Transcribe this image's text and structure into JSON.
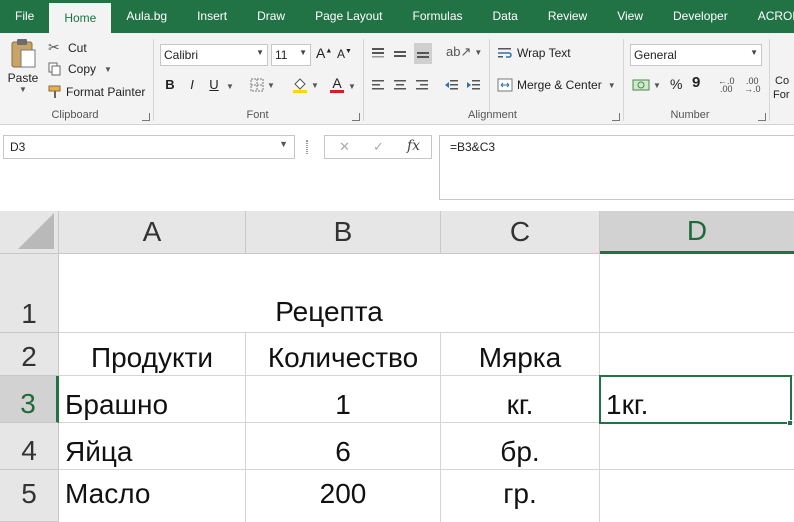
{
  "tabs": [
    "File",
    "Home",
    "Aula.bg",
    "Insert",
    "Draw",
    "Page Layout",
    "Formulas",
    "Data",
    "Review",
    "View",
    "Developer",
    "ACROBAT"
  ],
  "ribbon": {
    "clipboard": {
      "paste": "Paste",
      "cut": "Cut",
      "copy": "Copy",
      "format_painter": "Format Painter",
      "label": "Clipboard"
    },
    "font": {
      "name": "Calibri",
      "size": "11",
      "bold": "B",
      "italic": "I",
      "underline": "U",
      "font_color_letter": "A",
      "label": "Font"
    },
    "alignment": {
      "wrap_text": "Wrap Text",
      "merge_center": "Merge & Center",
      "label": "Alignment"
    },
    "number": {
      "format": "General",
      "percent": "%",
      "comma": "9",
      "label": "Number"
    },
    "styles": {
      "partial_top": "Co",
      "partial_bottom": "For"
    },
    "colors": {
      "green": "#217346",
      "fill_yellow": "#ffd700",
      "font_red": "#e0191e"
    }
  },
  "formula_bar": {
    "name_box": "D3",
    "cancel": "✕",
    "enter": "✓",
    "fx": "fx",
    "formula": "=B3&C3"
  },
  "sheet": {
    "columns": [
      "A",
      "B",
      "C",
      "D"
    ],
    "selected_column": "D",
    "rows": [
      {
        "num": "1",
        "merged_title": "Рецепта",
        "d": ""
      },
      {
        "num": "2",
        "a": "Продукти",
        "b": "Количество",
        "c": "Мярка",
        "d": ""
      },
      {
        "num": "3",
        "a": "Брашно",
        "b": "1",
        "c": "кг.",
        "d": "1кг."
      },
      {
        "num": "4",
        "a": "Яйца",
        "b": "6",
        "c": "бр.",
        "d": ""
      },
      {
        "num": "5",
        "a": "Масло",
        "b": "200",
        "c": "гр.",
        "d": ""
      }
    ],
    "selected_row": "3"
  }
}
